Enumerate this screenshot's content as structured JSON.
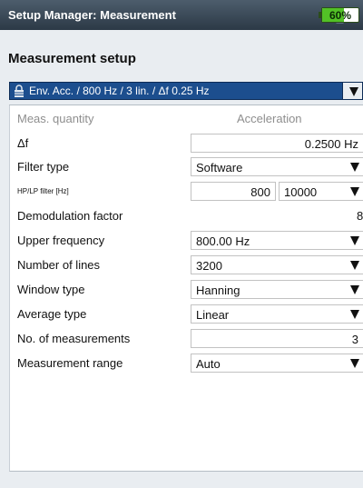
{
  "window": {
    "title": "Setup Manager: Measurement",
    "battery_percent": "60%",
    "battery_level": 0.6
  },
  "heading": "Measurement setup",
  "setup_select": {
    "value": "Env. Acc. / 800 Hz / 3 lin. / Δf 0.25 Hz"
  },
  "rows": {
    "meas_quantity": {
      "label": "Meas. quantity",
      "value": "Acceleration"
    },
    "delta_f": {
      "label": "Δf",
      "value": "0.2500 Hz"
    },
    "filter_type": {
      "label": "Filter type",
      "value": "Software"
    },
    "hplp_filter": {
      "label": "HP/LP filter [Hz]",
      "hp": "800",
      "lp": "10000"
    },
    "demod_factor": {
      "label": "Demodulation factor",
      "value": "8"
    },
    "upper_frequency": {
      "label": "Upper frequency",
      "value": "800.00 Hz"
    },
    "number_of_lines": {
      "label": "Number of lines",
      "value": "3200"
    },
    "window_type": {
      "label": "Window type",
      "value": "Hanning"
    },
    "average_type": {
      "label": "Average type",
      "value": "Linear"
    },
    "num_measurements": {
      "label": "No. of measurements",
      "value": "3"
    },
    "measurement_range": {
      "label": "Measurement range",
      "value": "Auto"
    }
  },
  "icons": {
    "dropdown": "triangle-down-icon",
    "network": "network-disconnected-icon",
    "battery": "battery-icon",
    "lock": "lock-icon"
  },
  "colors": {
    "selection": "#1c4e8e",
    "battery_fill": "#52c126",
    "network_x": "#d9261c"
  }
}
